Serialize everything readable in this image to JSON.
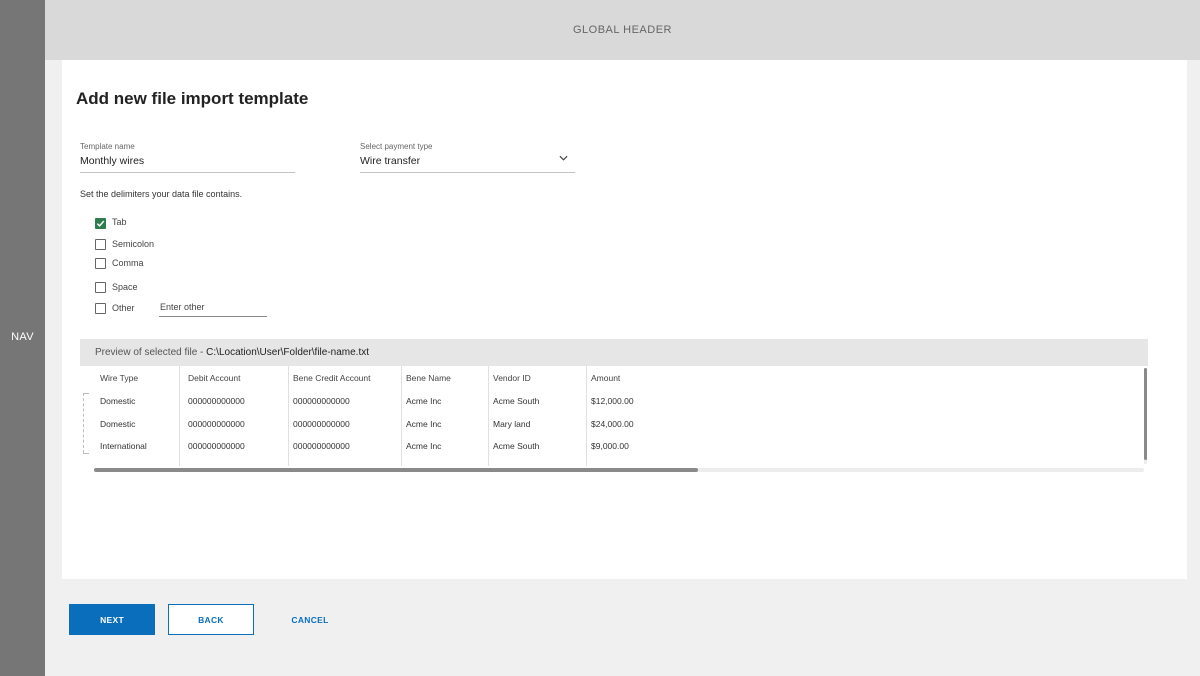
{
  "nav": {
    "label": "NAV"
  },
  "header": {
    "label": "GLOBAL HEADER"
  },
  "page": {
    "title": "Add new file import template"
  },
  "form": {
    "template_name": {
      "label": "Template name",
      "value": "Monthly wires"
    },
    "payment_type": {
      "label": "Select payment type",
      "value": "Wire transfer"
    },
    "instruction": "Set the delimiters your data file contains.",
    "delimiters": [
      {
        "label": "Tab",
        "checked": true
      },
      {
        "label": "Semicolon",
        "checked": false
      },
      {
        "label": "Comma",
        "checked": false
      },
      {
        "label": "Space",
        "checked": false
      },
      {
        "label": "Other",
        "checked": false
      }
    ],
    "other_placeholder": "Enter other"
  },
  "preview": {
    "prefix": "Preview of selected file - ",
    "path": "C:\\Location\\User\\Folder\\file-name.txt",
    "columns": [
      "Wire Type",
      "Debit Account",
      "Bene Credit Account",
      "Bene Name",
      "Vendor ID",
      "Amount"
    ],
    "rows": [
      [
        "Domestic",
        "000000000000",
        "000000000000",
        "Acme Inc",
        "Acme South",
        "$12,000.00"
      ],
      [
        "Domestic",
        "000000000000",
        "000000000000",
        "Acme Inc",
        "Mary land",
        "$24,000.00"
      ],
      [
        "International",
        "000000000000",
        "000000000000",
        "Acme Inc",
        "Acme South",
        "$9,000.00"
      ]
    ]
  },
  "actions": {
    "next": "NEXT",
    "back": "BACK",
    "cancel": "CANCEL"
  },
  "colors": {
    "accent": "#0a6ebd",
    "checkbox_checked": "#2e7d4f",
    "nav_bg": "#767676",
    "header_bg": "#d9d9d9"
  },
  "icons": {
    "payment_dropdown": "chevron-down-icon",
    "checked_box": "checkmark-icon"
  }
}
